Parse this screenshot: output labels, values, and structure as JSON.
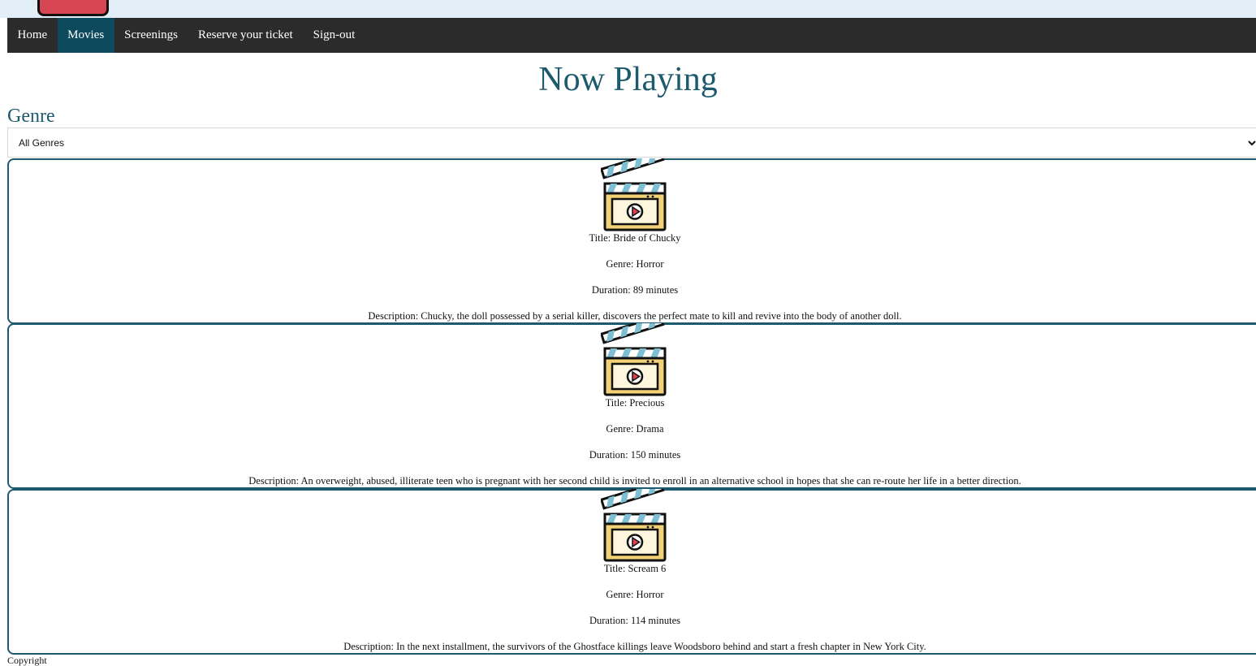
{
  "nav": {
    "items": [
      {
        "label": "Home",
        "active": false
      },
      {
        "label": "Movies",
        "active": true
      },
      {
        "label": "Screenings",
        "active": false
      },
      {
        "label": "Reserve your ticket",
        "active": false
      },
      {
        "label": "Sign-out",
        "active": false
      }
    ]
  },
  "page": {
    "title": "Now Playing"
  },
  "filter": {
    "label": "Genre",
    "selected": "All Genres",
    "icon": "chevron-down-icon"
  },
  "movies": [
    {
      "icon": "movie-clapperboard-icon",
      "title": "Title: Bride of Chucky",
      "genre": "Genre: Horror",
      "duration": "Duration: 89 minutes",
      "description": "Description: Chucky, the doll possessed by a serial killer, discovers the perfect mate to kill and revive into the body of another doll."
    },
    {
      "icon": "movie-clapperboard-icon",
      "title": "Title: Precious",
      "genre": "Genre: Drama",
      "duration": "Duration: 150 minutes",
      "description": "Description: An overweight, abused, illiterate teen who is pregnant with her second child is invited to enroll in an alternative school in hopes that she can re-route her life in a better direction."
    },
    {
      "icon": "movie-clapperboard-icon",
      "title": "Title: Scream 6",
      "genre": "Genre: Horror",
      "duration": "Duration: 114 minutes",
      "description": "Description: In the next installment, the survivors of the Ghostface killings leave Woodsboro behind and start a fresh chapter in New York City."
    }
  ],
  "footer": {
    "text": "Copyright"
  },
  "colors": {
    "navbar": "#2b2b2b",
    "nav_active": "#0e4a5e",
    "accent": "#1d5a6e",
    "top_strip": "#e2eff7",
    "logo_red": "#d64552"
  }
}
